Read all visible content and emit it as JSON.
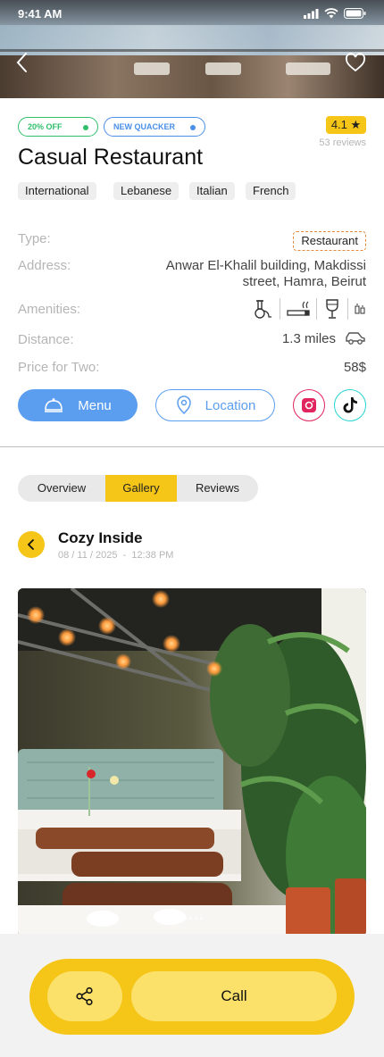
{
  "status": {
    "time": "9:41 AM"
  },
  "promos": [
    {
      "label": "20% OFF",
      "color": "#2fbf6b"
    },
    {
      "label": "NEW QUACKER",
      "color": "#4a8fe8"
    }
  ],
  "rating": {
    "value": "4.1",
    "reviews": "53 reviews"
  },
  "title": "Casual Restaurant",
  "cuisines": [
    "International",
    "Lebanese",
    "Italian",
    "French"
  ],
  "details": {
    "type_label": "Type:",
    "type_value": "Restaurant",
    "address_label": "Address:",
    "address_line1": "Anwar El-Khalil building, Makdissi",
    "address_line2": "street, Hamra, Beirut",
    "amenities_label": "Amenities:",
    "amenities": [
      "hookah-icon",
      "smoking-icon",
      "wine-glass-icon",
      "bar-icon"
    ],
    "distance_label": "Distance:",
    "distance_value": "1.3 miles",
    "price_label": "Price for Two:",
    "price_value": "58$"
  },
  "actions": {
    "menu_label": "Menu",
    "location_label": "Location"
  },
  "tabs": [
    "Overview",
    "Gallery",
    "Reviews"
  ],
  "active_tab": "Gallery",
  "gallery": {
    "title": "Cozy Inside",
    "date": "08 / 11 / 2025",
    "separator": "-",
    "time": "12:38 PM",
    "dots": 4,
    "active_dot": 1
  },
  "bottom": {
    "call_label": "Call"
  },
  "colors": {
    "accent": "#f5c518",
    "accent_light": "#fbe06a",
    "primary_blue": "#5b9ef0",
    "instagram": "#e0245e",
    "tiktok_border": "#25d3d0"
  }
}
